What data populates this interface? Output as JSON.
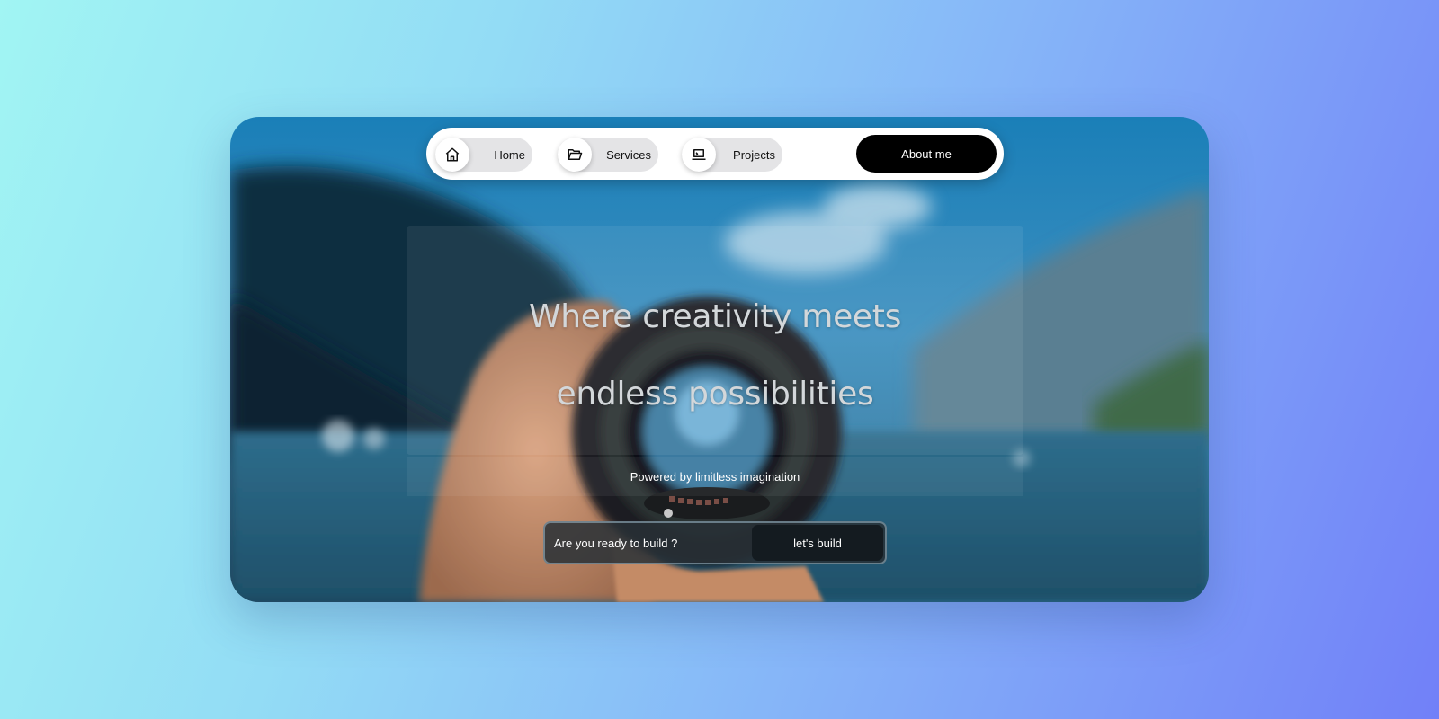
{
  "nav": {
    "items": [
      {
        "label": "Home",
        "icon": "home-icon"
      },
      {
        "label": "Services",
        "icon": "folder-open-icon"
      },
      {
        "label": "Projects",
        "icon": "laptop-icon"
      }
    ],
    "about_label": "About me"
  },
  "hero": {
    "title": "Where creativity meets endless possibilities",
    "subtitle": "Powered by limitless imagination"
  },
  "cta": {
    "prompt": "Are you ready to build ?",
    "button_label": "let's build"
  },
  "colors": {
    "page_gradient_start": "#a1f5f3",
    "page_gradient_end": "#7180f8",
    "nav_bg": "#ffffff",
    "about_button_bg": "#000000"
  }
}
